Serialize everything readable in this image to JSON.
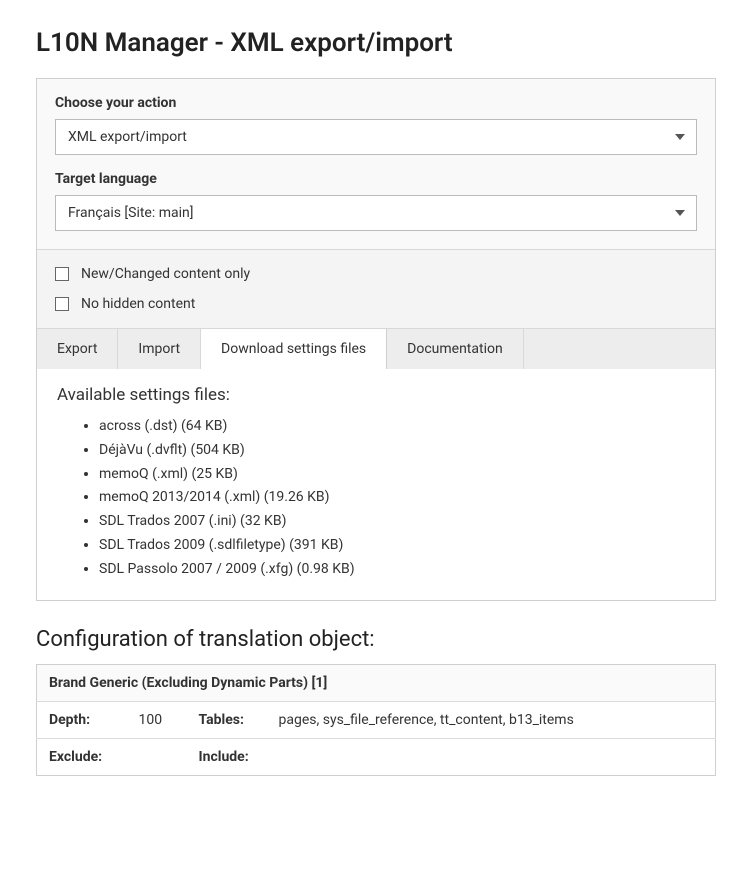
{
  "title": "L10N Manager - XML export/import",
  "action_section": {
    "label": "Choose your action",
    "value": "XML export/import"
  },
  "language_section": {
    "label": "Target language",
    "value": "Français [Site: main]"
  },
  "options": {
    "new_changed": "New/Changed content only",
    "no_hidden": "No hidden content"
  },
  "tabs": {
    "export": "Export",
    "import": "Import",
    "download": "Download settings files",
    "docs": "Documentation"
  },
  "files": {
    "heading": "Available settings files:",
    "items": [
      "across (.dst) (64 KB)",
      "DéjàVu (.dvflt) (504 KB)",
      "memoQ (.xml) (25 KB)",
      "memoQ 2013/2014 (.xml) (19.26 KB)",
      "SDL Trados 2007 (.ini) (32 KB)",
      "SDL Trados 2009 (.sdlfiletype) (391 KB)",
      "SDL Passolo 2007 / 2009 (.xfg) (0.98 KB)"
    ]
  },
  "config": {
    "heading": "Configuration of translation object:",
    "object_name": "Brand Generic (Excluding Dynamic Parts) [1]",
    "depth_label": "Depth:",
    "depth_value": "100",
    "tables_label": "Tables:",
    "tables_value": "pages, sys_file_reference, tt_content, b13_items",
    "exclude_label": "Exclude:",
    "exclude_value": "",
    "include_label": "Include:",
    "include_value": ""
  }
}
